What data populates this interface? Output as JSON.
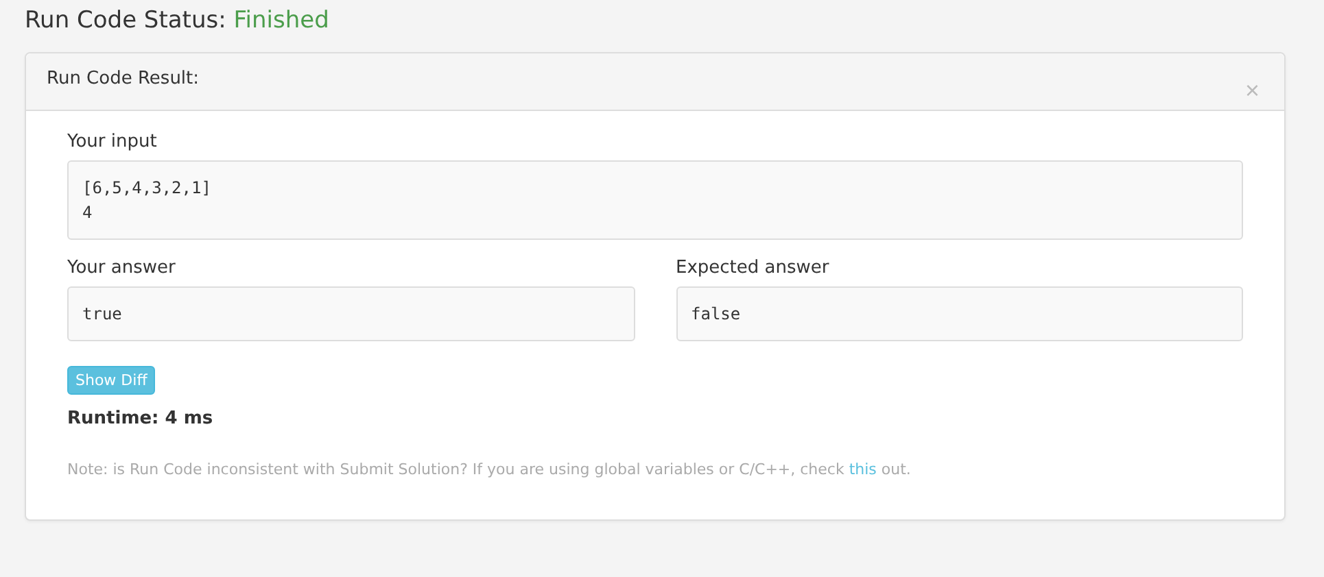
{
  "status": {
    "label": "Run Code Status:",
    "value": "Finished",
    "kind": "success"
  },
  "panel": {
    "title": "Run Code Result:",
    "close": "×"
  },
  "input": {
    "label": "Your input",
    "lines": [
      "[6,5,4,3,2,1]",
      "4"
    ]
  },
  "answers": [
    {
      "label": "Your answer",
      "value": "true"
    },
    {
      "label": "Expected answer",
      "value": "false"
    }
  ],
  "diff_button": "Show Diff",
  "runtime": "Runtime: 4 ms",
  "note": {
    "before": "Note: is Run Code inconsistent with Submit Solution? If you are using global variables or C/C++, check ",
    "link": "this",
    "after": " out."
  }
}
